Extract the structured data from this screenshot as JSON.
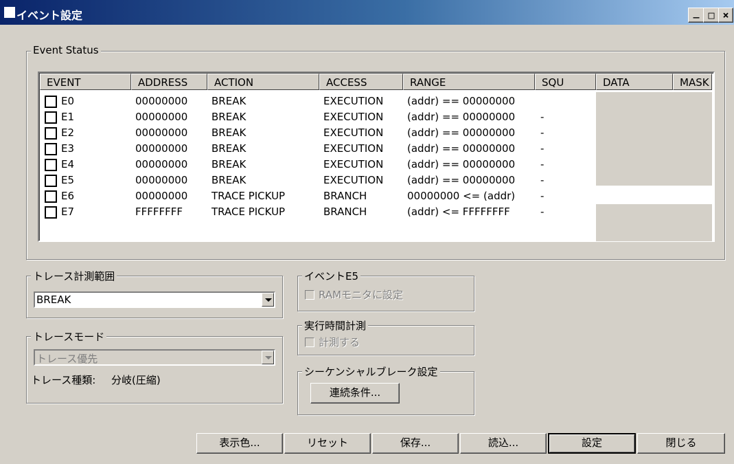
{
  "window": {
    "title": "イベント設定",
    "buttons": {
      "minimize": "_",
      "maximize": "□",
      "close": "×"
    }
  },
  "event_status": {
    "legend": "Event Status",
    "columns": [
      "EVENT",
      "ADDRESS",
      "ACTION",
      "ACCESS",
      "RANGE",
      "SQU",
      "DATA",
      "MASK"
    ],
    "rows": [
      {
        "event": "E0",
        "address": "00000000",
        "action": "BREAK",
        "access": "EXECUTION",
        "range": "(addr) == 00000000",
        "squ": "",
        "checked": false
      },
      {
        "event": "E1",
        "address": "00000000",
        "action": "BREAK",
        "access": "EXECUTION",
        "range": "(addr) == 00000000",
        "squ": "-",
        "checked": false
      },
      {
        "event": "E2",
        "address": "00000000",
        "action": "BREAK",
        "access": "EXECUTION",
        "range": "(addr) == 00000000",
        "squ": "-",
        "checked": false
      },
      {
        "event": "E3",
        "address": "00000000",
        "action": "BREAK",
        "access": "EXECUTION",
        "range": "(addr) == 00000000",
        "squ": "-",
        "checked": false
      },
      {
        "event": "E4",
        "address": "00000000",
        "action": "BREAK",
        "access": "EXECUTION",
        "range": "(addr) == 00000000",
        "squ": "-",
        "checked": false
      },
      {
        "event": "E5",
        "address": "00000000",
        "action": "BREAK",
        "access": "EXECUTION",
        "range": "(addr) == 00000000",
        "squ": "-",
        "checked": false
      },
      {
        "event": "E6",
        "address": "00000000",
        "action": "TRACE PICKUP",
        "access": "BRANCH",
        "range": "00000000 <= (addr)",
        "squ": "-",
        "checked": false
      },
      {
        "event": "E7",
        "address": "FFFFFFFF",
        "action": "TRACE PICKUP",
        "access": "BRANCH",
        "range": "(addr) <= FFFFFFFF",
        "squ": "-",
        "checked": false
      }
    ]
  },
  "trace_range": {
    "legend": "トレース計測範囲",
    "value": "BREAK"
  },
  "trace_mode": {
    "legend": "トレースモード",
    "value": "トレース優先",
    "type_label": "トレース種類:",
    "type_value": "分岐(圧縮)"
  },
  "event_e5": {
    "legend": "イベントE5",
    "checkbox_label": "RAMモニタに設定"
  },
  "exec_time": {
    "legend": "実行時間計測",
    "checkbox_label": "計測する"
  },
  "sequential_break": {
    "legend": "シーケンシャルブレーク設定",
    "button": "連続条件..."
  },
  "footer_buttons": {
    "display_color": "表示色...",
    "reset": "リセット",
    "save": "保存...",
    "load": "読込...",
    "set": "設定",
    "close": "閉じる"
  }
}
